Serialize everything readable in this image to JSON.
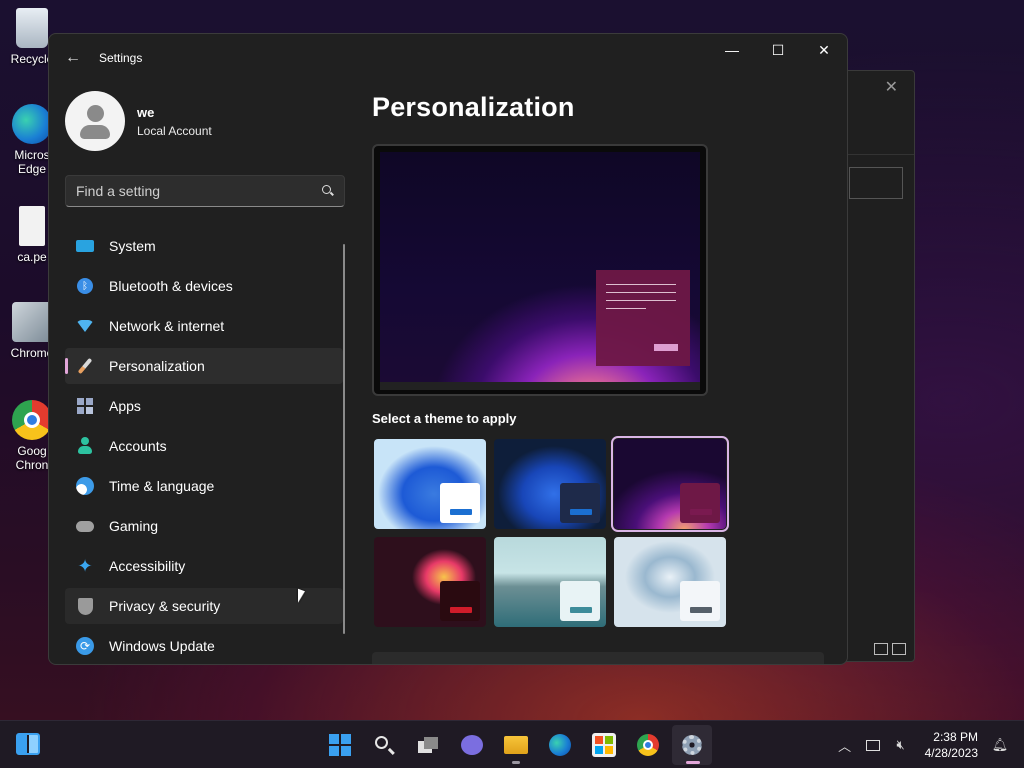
{
  "desktop": {
    "icons": [
      {
        "label": "Recycle"
      },
      {
        "label": "Micros\nEdge"
      },
      {
        "label": "ca.pe"
      },
      {
        "label": "Chrome"
      },
      {
        "label": "Goog\nChron"
      }
    ]
  },
  "window": {
    "title": "Settings",
    "controls": {
      "minimize": "—",
      "maximize": "☐",
      "close": "✕"
    }
  },
  "profile": {
    "name": "we",
    "account_type": "Local Account"
  },
  "search": {
    "placeholder": "Find a setting"
  },
  "nav": {
    "items": [
      {
        "label": "System",
        "icon": "system-icon",
        "color": "#29a3e0"
      },
      {
        "label": "Bluetooth & devices",
        "icon": "bluetooth-icon",
        "color": "#3a8ee6"
      },
      {
        "label": "Network & internet",
        "icon": "wifi-icon",
        "color": "#4fb4f0"
      },
      {
        "label": "Personalization",
        "icon": "brush-icon",
        "color": "#e8a060",
        "active": true
      },
      {
        "label": "Apps",
        "icon": "apps-icon",
        "color": "#9aa8c8"
      },
      {
        "label": "Accounts",
        "icon": "person-icon",
        "color": "#2dc2a0"
      },
      {
        "label": "Time & language",
        "icon": "globe-clock-icon",
        "color": "#3d9be8"
      },
      {
        "label": "Gaming",
        "icon": "gamepad-icon",
        "color": "#a0a0a0"
      },
      {
        "label": "Accessibility",
        "icon": "accessibility-icon",
        "color": "#3aa6f0"
      },
      {
        "label": "Privacy & security",
        "icon": "shield-icon",
        "color": "#9a9a9a"
      },
      {
        "label": "Windows Update",
        "icon": "update-icon",
        "color": "#3a9ae8"
      }
    ]
  },
  "main": {
    "title": "Personalization",
    "theme_section_label": "Select a theme to apply",
    "themes": [
      {
        "name": "windows-light",
        "card": "#ffffff",
        "bar": "#1b6fd1"
      },
      {
        "name": "windows-dark",
        "card": "#1e2a4a",
        "bar": "#1b6fd1"
      },
      {
        "name": "glow",
        "card": "#6e1846",
        "bar": "#6e1846",
        "selected": true
      },
      {
        "name": "captured-motion",
        "card": "#2a0a10",
        "bar": "#d01c2a"
      },
      {
        "name": "sunrise",
        "card": "#e8f3f5",
        "bar": "#3d8c9a"
      },
      {
        "name": "flow",
        "card": "#f3f6f9",
        "bar": "#56606a"
      }
    ]
  },
  "taskbar": {
    "apps": [
      "start-icon",
      "search-icon",
      "task-view-icon",
      "chat-icon",
      "file-explorer-icon",
      "edge-icon",
      "store-icon",
      "chrome-icon",
      "settings-icon"
    ],
    "time": "2:38 PM",
    "date": "4/28/2023"
  },
  "colors": {
    "accent": "#e2a6d9",
    "window_bg": "#202020"
  }
}
